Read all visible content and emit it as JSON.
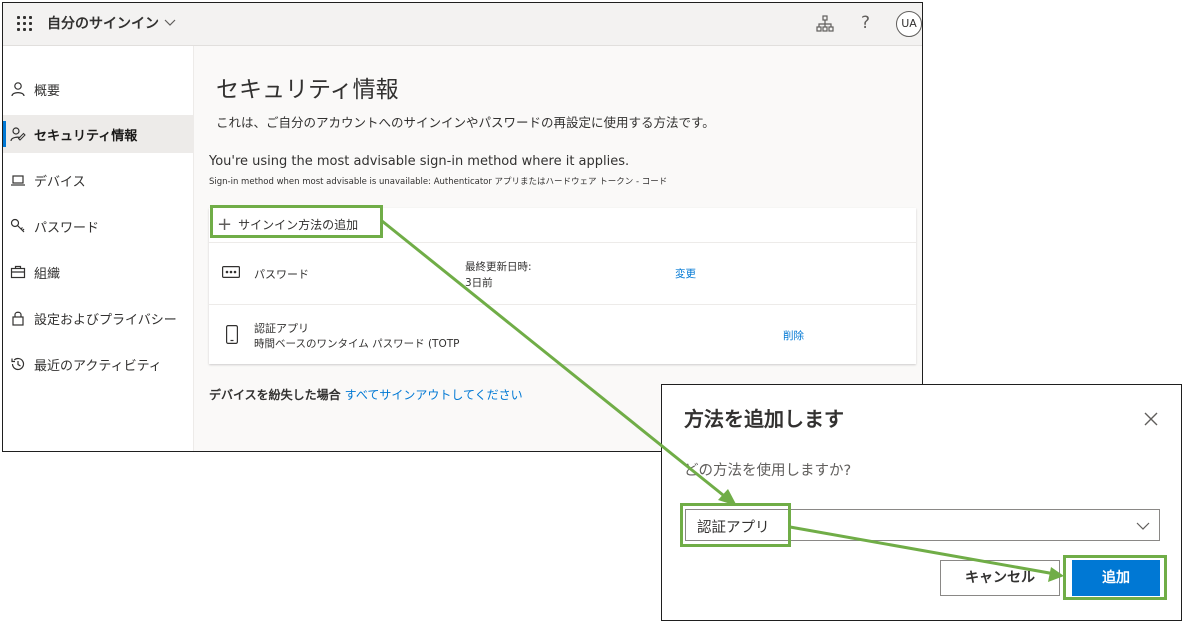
{
  "header": {
    "app_title": "自分のサインイン",
    "avatar_initials": "UA",
    "help_glyph": "?"
  },
  "sidebar": {
    "items": [
      {
        "label": "概要",
        "icon": "person-icon"
      },
      {
        "label": "セキュリティ情報",
        "icon": "security-info-icon",
        "active": true
      },
      {
        "label": "デバイス",
        "icon": "laptop-icon"
      },
      {
        "label": "パスワード",
        "icon": "key-icon"
      },
      {
        "label": "組織",
        "icon": "briefcase-icon"
      },
      {
        "label": "設定およびプライバシー",
        "icon": "lock-icon"
      },
      {
        "label": "最近のアクティビティ",
        "icon": "history-icon"
      }
    ]
  },
  "main": {
    "title": "セキュリティ情報",
    "description": "これは、ご自分のアカウントへのサインインやパスワードの再設定に使用する方法です。",
    "advisable": "You're using the most advisable sign-in method where it applies.",
    "advisable_sub": "Sign-in method when most advisable is unavailable: Authenticator アプリまたはハードウェア トークン - コード",
    "add_method": "サインイン方法の追加",
    "methods": [
      {
        "name": "パスワード",
        "last_updated_label": "最終更新日時:",
        "last_updated_value": "3日前",
        "action": "変更"
      },
      {
        "name": "認証アプリ",
        "detail": "時間ベースのワンタイム パスワード (TOTP",
        "action": "削除"
      }
    ],
    "lost_device_label": "デバイスを紛失した場合",
    "lost_device_link": "すべてサインアウトしてください"
  },
  "dialog": {
    "title": "方法を追加します",
    "question": "どの方法を使用しますか?",
    "selected_method": "認証アプリ",
    "cancel_label": "キャンセル",
    "add_label": "追加"
  },
  "colors": {
    "accent": "#0078d4",
    "highlight": "#70ad47"
  }
}
